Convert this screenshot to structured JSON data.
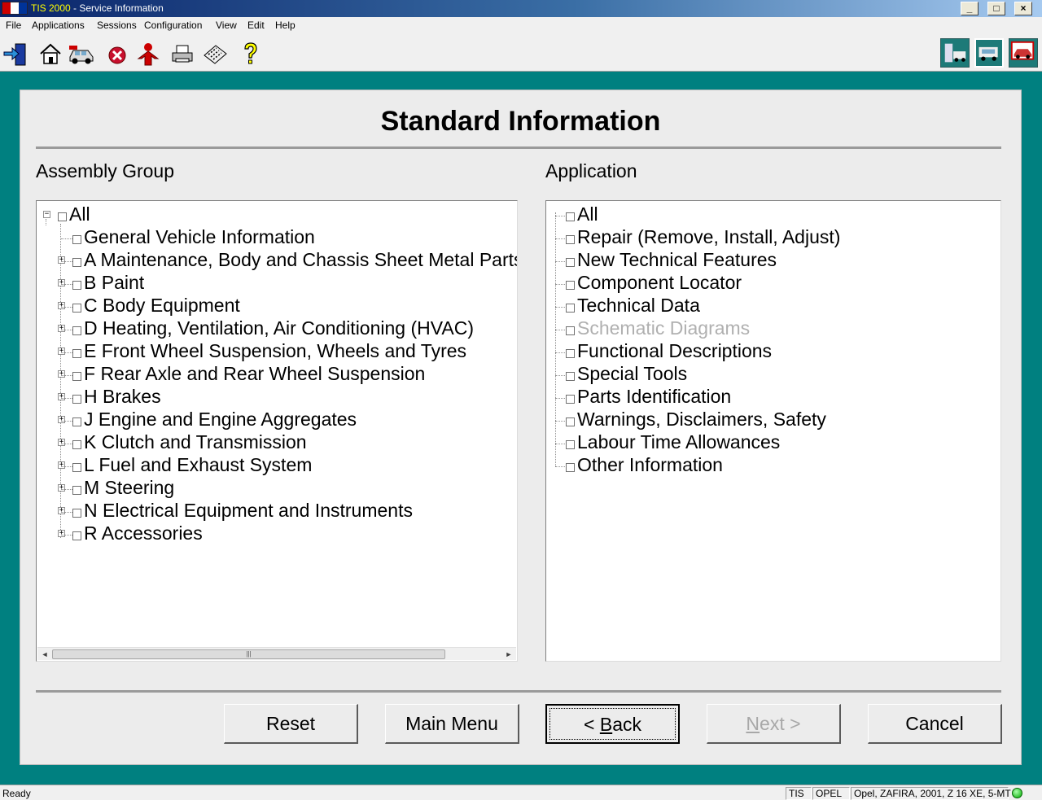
{
  "window": {
    "app_name": "TIS 2000",
    "title_rest": " - Service Information",
    "minimize": "_",
    "maximize": "□",
    "close": "×"
  },
  "menu": [
    "File",
    "Applications",
    "Sessions",
    "Configuration",
    "View",
    "Edit",
    "Help"
  ],
  "toolbar": {
    "left_icons": [
      "exit-icon",
      "home-icon",
      "vehicle-icon",
      "stop-icon",
      "person-icon",
      "print-icon",
      "keyboard-icon",
      "help-icon"
    ],
    "right_icons": [
      "service-station-icon",
      "diagnostics-icon",
      "car-info-icon"
    ]
  },
  "page": {
    "title": "Standard Information",
    "assembly_group_label": "Assembly Group",
    "application_label": "Application"
  },
  "assembly_tree": [
    {
      "label": "All",
      "expander": "minus",
      "level": 0
    },
    {
      "label": "General Vehicle Information",
      "expander": "none",
      "level": 1
    },
    {
      "label": "A  Maintenance, Body and Chassis Sheet Metal Parts",
      "expander": "plus",
      "level": 1
    },
    {
      "label": "B  Paint",
      "expander": "plus",
      "level": 1
    },
    {
      "label": "C  Body Equipment",
      "expander": "plus",
      "level": 1
    },
    {
      "label": "D  Heating, Ventilation, Air Conditioning (HVAC)",
      "expander": "plus",
      "level": 1
    },
    {
      "label": "E  Front Wheel Suspension, Wheels and Tyres",
      "expander": "plus",
      "level": 1
    },
    {
      "label": "F  Rear Axle and Rear Wheel Suspension",
      "expander": "plus",
      "level": 1
    },
    {
      "label": "H  Brakes",
      "expander": "plus",
      "level": 1
    },
    {
      "label": "J  Engine and Engine Aggregates",
      "expander": "plus",
      "level": 1
    },
    {
      "label": "K  Clutch and Transmission",
      "expander": "plus",
      "level": 1
    },
    {
      "label": "L  Fuel and Exhaust System",
      "expander": "plus",
      "level": 1
    },
    {
      "label": "M  Steering",
      "expander": "plus",
      "level": 1
    },
    {
      "label": "N  Electrical Equipment and Instruments",
      "expander": "plus",
      "level": 1
    },
    {
      "label": "R  Accessories",
      "expander": "plus",
      "level": 1
    }
  ],
  "application_tree": [
    {
      "label": "All",
      "enabled": true
    },
    {
      "label": "Repair (Remove, Install, Adjust)",
      "enabled": true
    },
    {
      "label": "New Technical Features",
      "enabled": true
    },
    {
      "label": "Component Locator",
      "enabled": true
    },
    {
      "label": "Technical Data",
      "enabled": true
    },
    {
      "label": "Schematic Diagrams",
      "enabled": false
    },
    {
      "label": "Functional Descriptions",
      "enabled": true
    },
    {
      "label": "Special Tools",
      "enabled": true
    },
    {
      "label": "Parts Identification",
      "enabled": true
    },
    {
      "label": "Warnings, Disclaimers, Safety",
      "enabled": true
    },
    {
      "label": "Labour Time Allowances",
      "enabled": true
    },
    {
      "label": "Other Information",
      "enabled": true
    }
  ],
  "buttons": {
    "reset": "Reset",
    "main_menu": "Main Menu",
    "back_prefix": "< ",
    "back_mnemonic": "B",
    "back_rest": "ack",
    "next_mnemonic": "N",
    "next_rest": "ext >",
    "cancel": "Cancel"
  },
  "scrollbar": {
    "left_arrow": "◄",
    "right_arrow": "►",
    "grip": "|||"
  },
  "status": {
    "text": "Ready",
    "system": "TIS",
    "brand": "OPEL",
    "vehicle": "Opel, ZAFIRA, 2001, Z 16 XE, 5-MT"
  },
  "colors": {
    "frame": "#008080",
    "panel": "#ececec",
    "disabled_text": "#b0b0b0"
  }
}
